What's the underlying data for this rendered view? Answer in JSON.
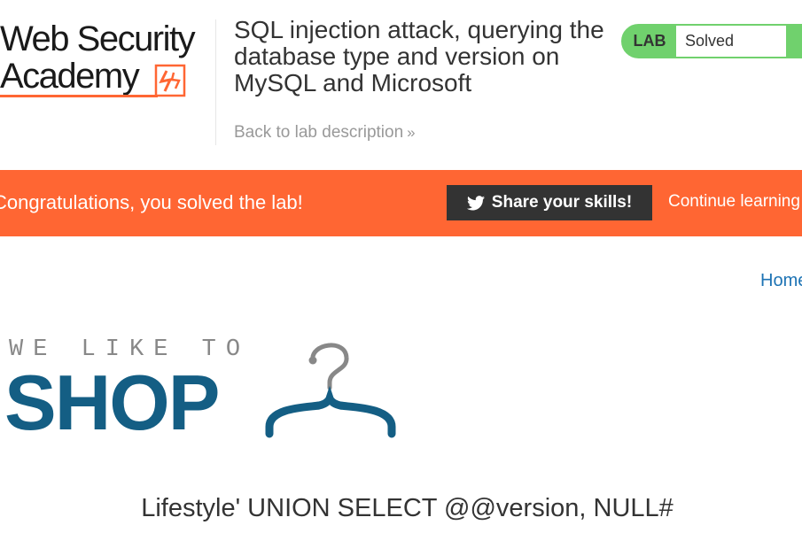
{
  "header": {
    "logo": {
      "line1": "Web Security",
      "line2": "Academy",
      "accent": "#ff6633"
    },
    "lab_title": "SQL injection attack, querying the database type and version on MySQL and Microsoft",
    "back_link": "Back to lab description",
    "lab_status": {
      "label": "LAB",
      "value": "Solved",
      "color": "#70d16d"
    }
  },
  "banner": {
    "message": "Congratulations, you solved the lab!",
    "share_button": "Share your skills!",
    "share_icon": "twitter-icon",
    "continue_link": "Continue learning",
    "color": "#ff6633"
  },
  "nav": {
    "home": "Home"
  },
  "shop_logo": {
    "tagline": "WE LIKE TO",
    "word": "SHOP",
    "icon": "hanger-icon",
    "color": "#145e84"
  },
  "main": {
    "results_title": "Lifestyle' UNION SELECT @@version, NULL#"
  }
}
